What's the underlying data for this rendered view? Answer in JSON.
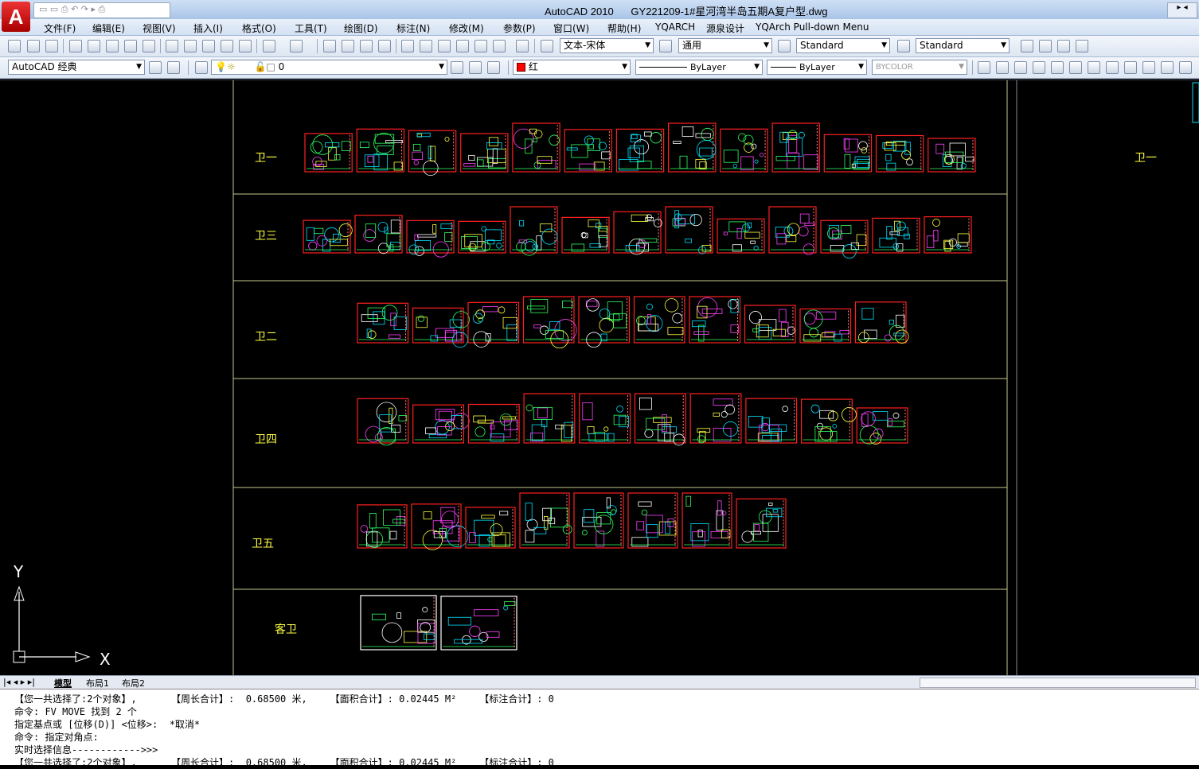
{
  "window": {
    "app_name": "AutoCAD 2010",
    "file_name": "GY221209-1#星河湾半岛五期A复户型.dwg"
  },
  "menu": [
    "文件(F)",
    "编辑(E)",
    "视图(V)",
    "插入(I)",
    "格式(O)",
    "工具(T)",
    "绘图(D)",
    "标注(N)",
    "修改(M)",
    "参数(P)",
    "窗口(W)",
    "帮助(H)",
    "YQARCH",
    "源泉设计",
    "YQArch Pull-down Menu"
  ],
  "toolbar1": {
    "text_style": "文本-宋体",
    "dim_style": "通用",
    "table_style": "Standard",
    "multileader_style": "Standard"
  },
  "toolbar2": {
    "workspace": "AutoCAD 经典",
    "layer": "0",
    "color": "红",
    "linetype": "ByLayer",
    "lineweight": "ByLayer",
    "plotstyle": "BYCOLOR"
  },
  "drawing": {
    "rows": [
      {
        "label": "卫一",
        "count": 13
      },
      {
        "label": "卫三",
        "count": 13
      },
      {
        "label": "卫二",
        "count": 10
      },
      {
        "label": "卫四",
        "count": 10
      },
      {
        "label": "卫五",
        "count": 8
      },
      {
        "label": "客卫",
        "count": 2
      }
    ],
    "side_label": "卫一",
    "ucs_x": "X",
    "ucs_y": "Y"
  },
  "tabs": [
    "模型",
    "布局1",
    "布局2"
  ],
  "command_history": [
    "【您一共选择了:2个对象】,      【周长合计】:  0.68500 米,    【面积合计】: 0.02445 M²    【标注合计】: 0",
    "命令: FV MOVE 找到 2 个",
    "指定基点或 [位移(D)] <位移>:  *取消*",
    "命令: 指定对角点:",
    "实时选择信息------------>>>",
    "【您一共选择了:2个对象】,      【周长合计】:  0.68500 米,    【面积合计】: 0.02445 M²    【标注合计】: 0"
  ],
  "colors": {
    "frame": "#ff2020",
    "label": "#ffff40",
    "divider": "#c8c890",
    "cyan": "#00e0ff",
    "magenta": "#ff40ff",
    "green": "#30ff60"
  }
}
